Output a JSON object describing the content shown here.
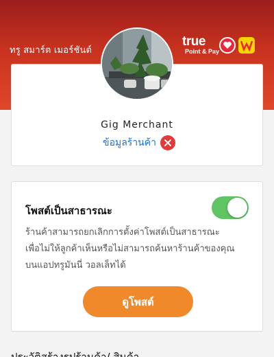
{
  "header": {
    "title": "ทรู สมาร์ต เมอร์ชันต์",
    "brand": {
      "name": "true",
      "sub": "Point & Pay"
    }
  },
  "colors": {
    "header_top": "#9c1d1d",
    "header_bottom": "#e0472a",
    "link": "#1d6fd6",
    "error": "#e23a3a",
    "toggle_on": "#5fc462",
    "primary_button": "#f0892a"
  },
  "profile": {
    "merchant_name": "Gig Merchant",
    "shop_info_label": "ข้อมูลร้านค้า",
    "status_icon": "error-x-icon"
  },
  "public_post": {
    "title": "โพสต์เป็นสาธารณะ",
    "toggle_on": true,
    "description_lines": [
      "ร้านค้าสามารถยกเลิกการตั้งค่าโพสต์เป็นสาธารณะ",
      "เพื่อไม่ให้ลูกค้าเห็นหรือไม่สามารถค้นหาร้านค้าของคุณ",
      "บนแอปทรูมันนี่ วอลเล็ทได้"
    ],
    "view_post_label": "ดูโพสต์"
  },
  "history": {
    "title": "ประวัติสร้างรูปร้านค้า/ สินค้า"
  }
}
